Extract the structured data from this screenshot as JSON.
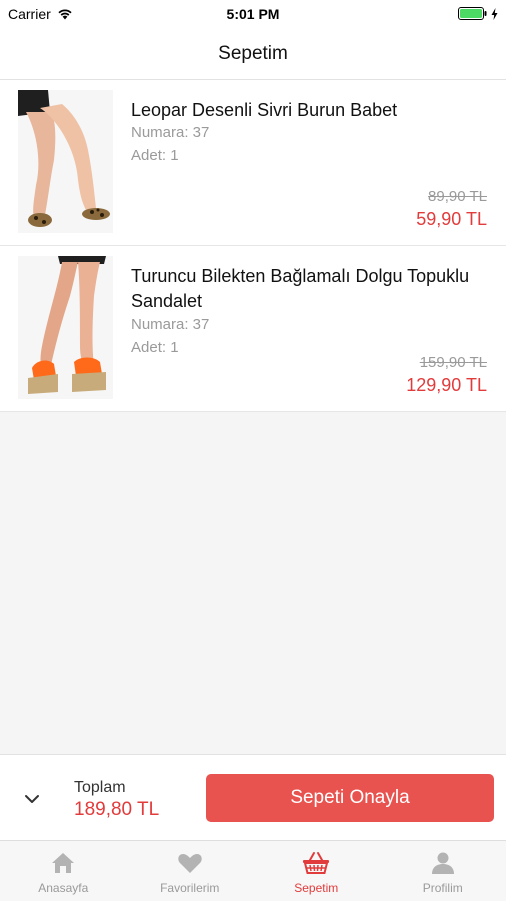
{
  "status_bar": {
    "carrier": "Carrier",
    "time": "5:01 PM"
  },
  "header": {
    "title": "Sepetim"
  },
  "cart": {
    "items": [
      {
        "name": "Leopar Desenli Sivri Burun Babet",
        "size": "Numara: 37",
        "quantity": "Adet: 1",
        "old_price": "89,90 TL",
        "new_price": "59,90 TL"
      },
      {
        "name": "Turuncu Bilekten Bağlamalı Dolgu Topuklu Sandalet",
        "size": "Numara: 37",
        "quantity": "Adet: 1",
        "old_price": "159,90 TL",
        "new_price": "129,90 TL"
      }
    ]
  },
  "summary": {
    "total_label": "Toplam",
    "total_value": "189,80 TL",
    "confirm_label": "Sepeti Onayla"
  },
  "tabs": [
    {
      "label": "Anasayfa",
      "icon": "home-icon",
      "active": false
    },
    {
      "label": "Favorilerim",
      "icon": "heart-icon",
      "active": false
    },
    {
      "label": "Sepetim",
      "icon": "basket-icon",
      "active": true
    },
    {
      "label": "Profilim",
      "icon": "user-icon",
      "active": false
    }
  ],
  "colors": {
    "accent": "#e8524f",
    "price_red": "#e23b3b",
    "muted": "#9a9a9a"
  }
}
